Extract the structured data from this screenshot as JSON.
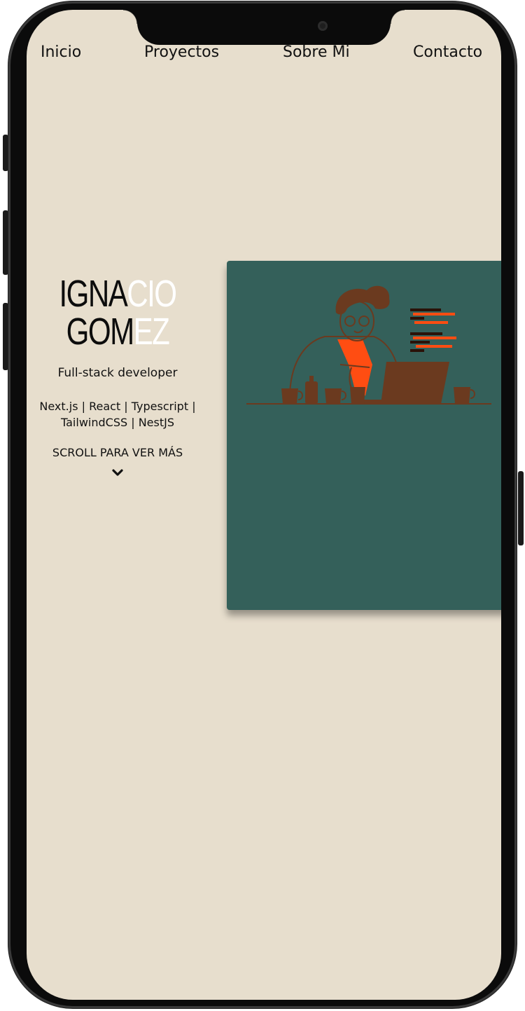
{
  "nav": {
    "items": [
      {
        "label": "Inicio"
      },
      {
        "label": "Proyectos"
      },
      {
        "label": "Sobre Mi"
      },
      {
        "label": "Contacto"
      }
    ]
  },
  "hero": {
    "name_line1_dark": "IGNA",
    "name_line1_light": "CIO",
    "name_line2_dark": "GOM",
    "name_line2_light": "EZ",
    "role": "Full-stack developer",
    "stack_line1": "Next.js | React | Typescript |",
    "stack_line2": "TailwindCSS | NestJS",
    "scroll_hint": "SCROLL PARA VER MÁS",
    "scroll_icon": "chevron-down-icon"
  },
  "colors": {
    "background": "#e7decd",
    "card": "#34605a",
    "accent": "#ff4d12",
    "illustration_brown": "#6b3a1f"
  }
}
